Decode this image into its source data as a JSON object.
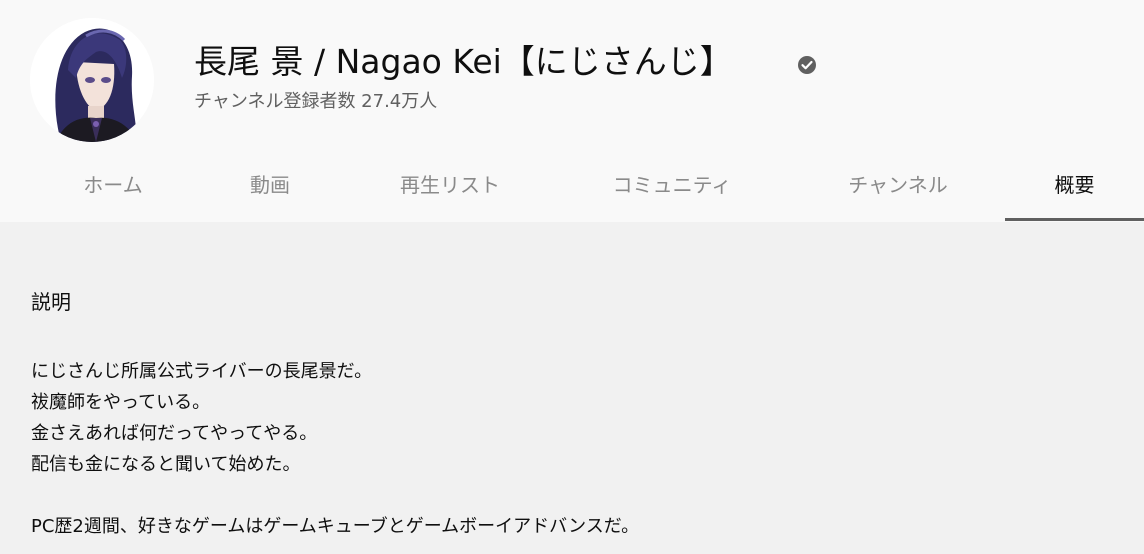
{
  "channel": {
    "name": "長尾 景 / Nagao Kei【にじさんじ】",
    "subscribers": "チャンネル登録者数 27.4万人",
    "verified_icon": "verified-check-icon",
    "avatar_icon": "channel-avatar"
  },
  "tabs": [
    {
      "label": "ホーム",
      "active": false
    },
    {
      "label": "動画",
      "active": false
    },
    {
      "label": "再生リスト",
      "active": false
    },
    {
      "label": "コミュニティ",
      "active": false
    },
    {
      "label": "チャンネル",
      "active": false
    },
    {
      "label": "概要",
      "active": true
    }
  ],
  "about": {
    "heading": "説明",
    "lines": [
      "にじさんじ所属公式ライバーの長尾景だ。",
      "祓魔師をやっている。",
      "金さえあれば何だってやってやる。",
      "配信も金になると聞いて始めた。",
      "",
      "PC歴2週間、好きなゲームはゲームキューブとゲームボーイアドバンスだ。"
    ]
  },
  "colors": {
    "header_bg": "#f9f9f9",
    "page_bg": "#f1f1f1",
    "tab_inactive": "#8a8a8a",
    "tab_active": "#0f0f0f",
    "underline": "#606060"
  }
}
